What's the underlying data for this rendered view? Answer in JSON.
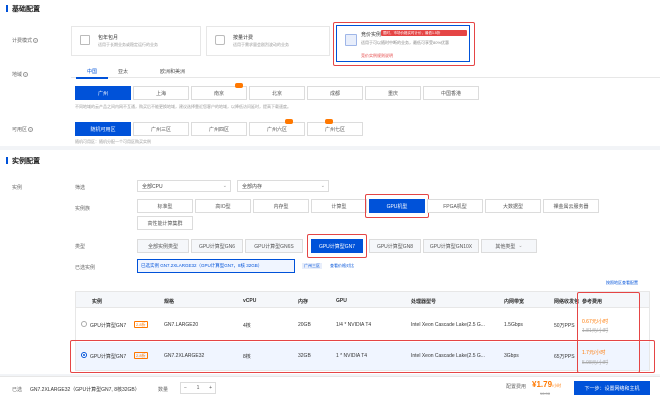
{
  "basic": {
    "title": "基础配置",
    "billing_label": "计费模式",
    "billing": [
      {
        "title": "包年包月",
        "desc": "适用于长期业务或稳定运行的业务"
      },
      {
        "title": "按量计费",
        "desc": "适用于需求量会剧烈波动的业务"
      },
      {
        "title": "竞价实例",
        "badge": "限时，市场价格实时计价，最低1.5折",
        "desc": "适用于可以随时中断的业务，最低可享受80%优惠",
        "link": "竞价实例规则说明"
      }
    ],
    "region_label": "地域",
    "region_groups": [
      "中国",
      "亚太",
      "欧洲和美洲"
    ],
    "regions": [
      "广州",
      "上海",
      "南京",
      "北京",
      "成都",
      "重庆",
      "中国香港"
    ],
    "region_note": "不同地域的云产品之间内网不互通，购买后不能更换地域，建议选择靠近您客户的地域，以降低访问延时，提高下载速度。",
    "zone_label": "可用区",
    "zones": [
      "随机可用区",
      "广州三区",
      "广州四区",
      "广州六区",
      "广州七区"
    ],
    "zone_note": "随机可用区：随机分配一个可用区购买实例"
  },
  "instance": {
    "title": "实例配置",
    "instance_label": "实例",
    "filter_label": "筛选",
    "cpu_filter": "全部CPU",
    "mem_filter": "全部内存",
    "family_label": "实例族",
    "families": [
      "标准型",
      "高IO型",
      "内存型",
      "计算型",
      "GPU机型",
      "FPGA机型",
      "大数据型",
      "裸金属云服务器",
      "高性能计算集群"
    ],
    "type_label": "类型",
    "types": [
      "全部实例类型",
      "GPU计算型GN6",
      "GPU计算型GN6S",
      "GPU计算型GN7",
      "GPU计算型GN8",
      "GPU计算型GN10X",
      "其他类型"
    ],
    "selected_label": "已选实例",
    "selected_value": "已选实例 GN7.2XLARGE32（GPU计算型GN7，8核 32GB）",
    "selected_tag1": "广州三区",
    "selected_tag2": "查看价格对比",
    "compare_link": "按照地区查看配置",
    "table": {
      "headers": [
        "实例",
        "规格",
        "vCPU",
        "内存",
        "GPU",
        "处理器型号",
        "内网带宽",
        "网络收发包",
        "参考费用"
      ],
      "rows": [
        {
          "instance": "GPU计算型GN7",
          "tag": "2.8折",
          "spec": "GN7.LARGE20",
          "vcpu": "4核",
          "mem": "20GB",
          "gpu": "1/4 * NVIDIA T4",
          "cpu_model": "Intel Xeon Cascade Lake(2.5 G...",
          "bandwidth": "1.5Gbps",
          "pps": "50万PPS",
          "price": "0.67元/小时",
          "orig": "1.81元/小时"
        },
        {
          "instance": "GPU计算型GN7",
          "tag": "2.8折",
          "spec": "GN7.2XLARGE32",
          "vcpu": "8核",
          "mem": "32GB",
          "gpu": "1 * NVIDIA T4",
          "cpu_model": "Intel Xeon Cascade Lake(2.5 G...",
          "bandwidth": "3Gbps",
          "pps": "65万PPS",
          "price": "1.7元/小时",
          "orig": "5.98元/小时"
        }
      ]
    }
  },
  "footer": {
    "selected_label": "已选",
    "selected_value": "GN7.2XLARGE32（GPU计算型GN7, 8核32GB）",
    "qty_label": "数量",
    "qty": "1",
    "minus": "−",
    "plus": "+",
    "fee_label": "配置费用",
    "price": "¥1.79",
    "price_unit": "/小时",
    "orig_price": "¥6.98",
    "next_button": "下一步：设置网络和主机"
  },
  "colors": {
    "accent": "#0052d9",
    "warn": "#ff7800",
    "highlight": "#e54545"
  }
}
